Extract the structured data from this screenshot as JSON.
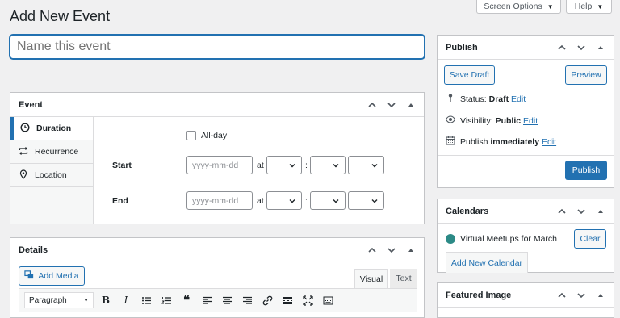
{
  "page": {
    "title": "Add New Event",
    "screen_options_label": "Screen Options",
    "help_label": "Help",
    "name_placeholder": "Name this event"
  },
  "event_box": {
    "title": "Event",
    "tabs": [
      {
        "label": "Duration",
        "icon": "clock-icon"
      },
      {
        "label": "Recurrence",
        "icon": "repeat-icon"
      },
      {
        "label": "Location",
        "icon": "location-pin-icon"
      }
    ],
    "all_day_label": "All-day",
    "start_label": "Start",
    "end_label": "End",
    "date_placeholder": "yyyy-mm-dd",
    "at_label": "at",
    "colon": ":"
  },
  "details_box": {
    "title": "Details",
    "add_media_label": "Add Media",
    "tab_visual": "Visual",
    "tab_text": "Text",
    "format_select_value": "Paragraph"
  },
  "publish_box": {
    "title": "Publish",
    "save_draft_label": "Save Draft",
    "preview_label": "Preview",
    "status_label": "Status:",
    "status_value": "Draft",
    "visibility_label": "Visibility:",
    "visibility_value": "Public",
    "publish_label": "Publish",
    "publish_value": "immediately",
    "edit_label": "Edit",
    "publish_button_label": "Publish"
  },
  "calendars_box": {
    "title": "Calendars",
    "calendar_name": "Virtual Meetups for March",
    "calendar_color": "#2c8a86",
    "clear_label": "Clear",
    "add_new_label": "Add New Calendar"
  },
  "featured_box": {
    "title": "Featured Image"
  },
  "colors": {
    "accent": "#2271b1",
    "background": "#f0f0f1"
  }
}
